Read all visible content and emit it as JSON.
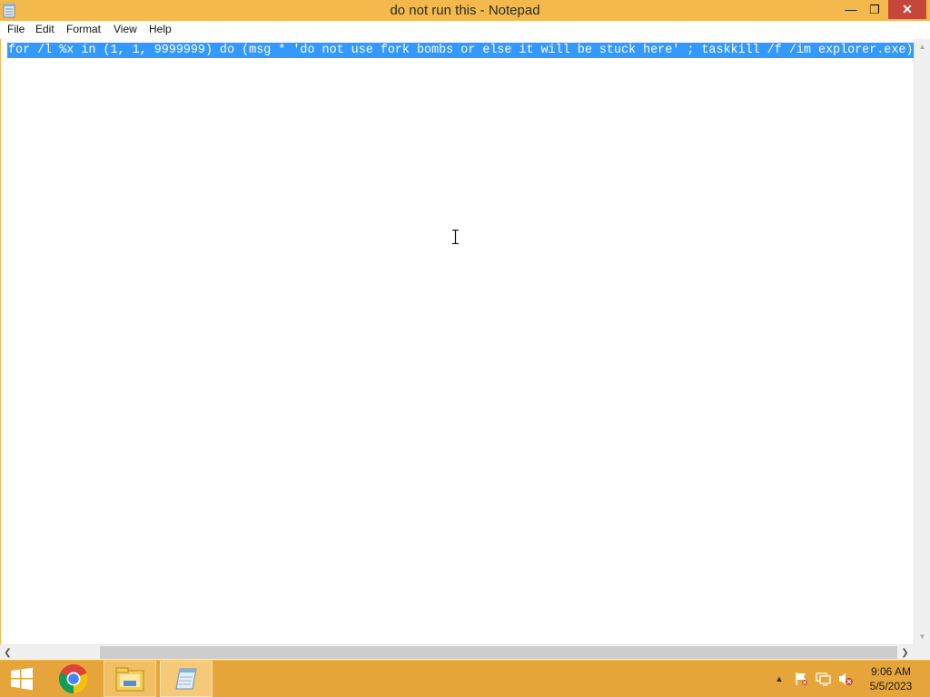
{
  "window": {
    "title": "do not run this - Notepad",
    "minimize_glyph": "—",
    "maximize_glyph": "❐",
    "close_glyph": "✕"
  },
  "menu": {
    "items": [
      "File",
      "Edit",
      "Format",
      "View",
      "Help"
    ]
  },
  "editor": {
    "content": "for /l %x in (1, 1, 9999999) do (msg * 'do not use fork bombs or else it will be stuck here' ; taskkill /f /im explorer.exe)",
    "selected": true,
    "selection_color": "#3399ff"
  },
  "scrollbars": {
    "up_glyph": "▲",
    "down_glyph": "▼",
    "left_glyph": "❮",
    "right_glyph": "❯"
  },
  "taskbar": {
    "apps": [
      "windows-start-icon",
      "chrome-icon",
      "file-explorer-icon",
      "notepad-icon"
    ],
    "tray": {
      "show_hidden_glyph": "▲",
      "time": "9:06 AM",
      "date": "5/5/2023"
    }
  },
  "colors": {
    "window_frame": "#f4b94c",
    "taskbar": "#e6a53a",
    "close_button": "#c7463a"
  }
}
